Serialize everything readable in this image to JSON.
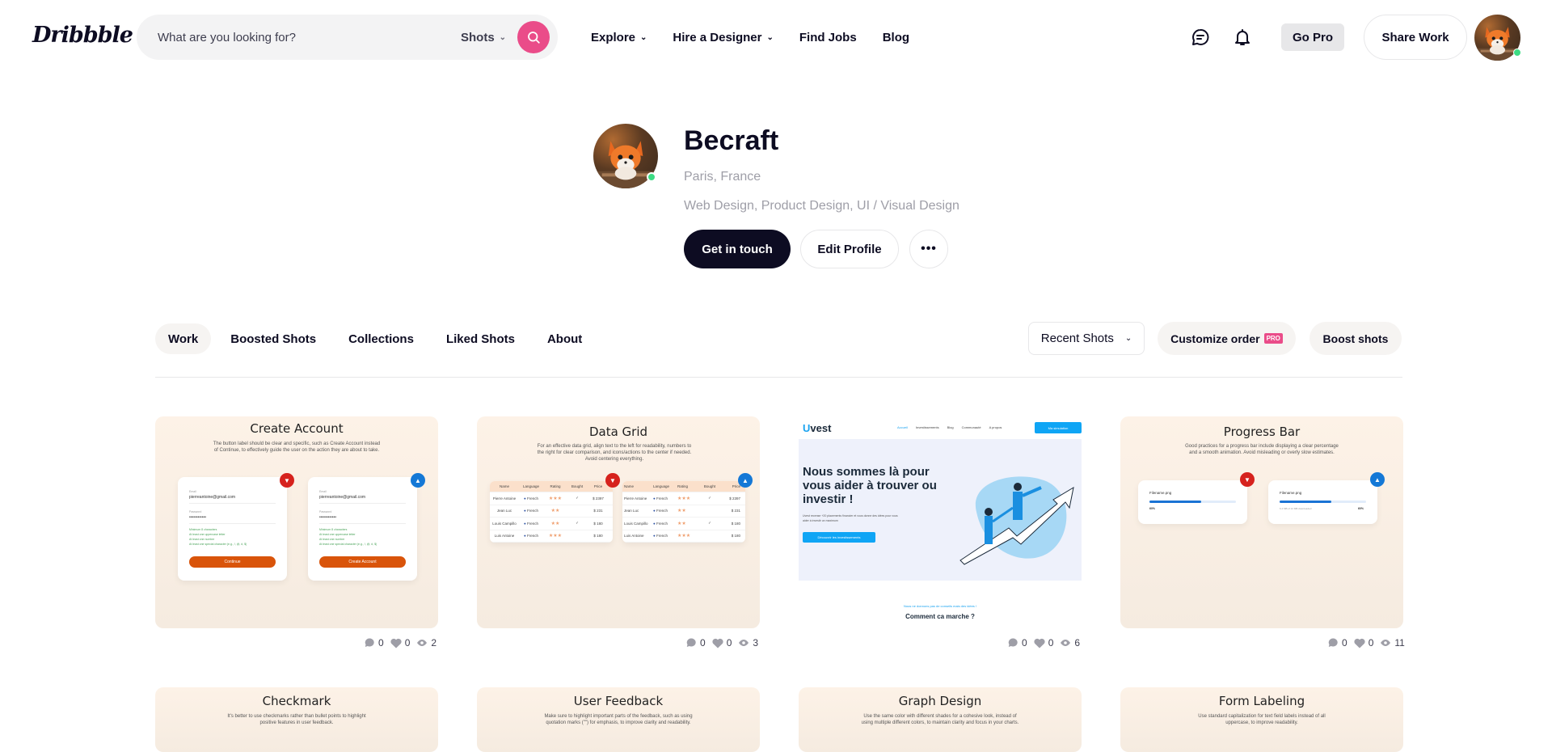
{
  "header": {
    "logo": "Dribbble",
    "search": {
      "placeholder": "What are you looking for?",
      "scope": "Shots"
    },
    "nav": [
      {
        "label": "Explore",
        "has_dropdown": true
      },
      {
        "label": "Hire a Designer",
        "has_dropdown": true
      },
      {
        "label": "Find Jobs",
        "has_dropdown": false
      },
      {
        "label": "Blog",
        "has_dropdown": false
      }
    ],
    "go_pro": "Go Pro",
    "share_work": "Share Work"
  },
  "profile": {
    "name": "Becraft",
    "location": "Paris, France",
    "skills": "Web Design, Product Design, UI / Visual Design",
    "get_in_touch": "Get in touch",
    "edit_profile": "Edit Profile",
    "more": "•••",
    "online": true
  },
  "tabs": [
    {
      "label": "Work",
      "active": true
    },
    {
      "label": "Boosted Shots",
      "active": false
    },
    {
      "label": "Collections",
      "active": false
    },
    {
      "label": "Liked Shots",
      "active": false
    },
    {
      "label": "About",
      "active": false
    }
  ],
  "controls": {
    "sort": "Recent Shots",
    "customize": "Customize order",
    "pro_badge": "PRO",
    "boost": "Boost shots"
  },
  "shots": [
    {
      "title": "Create Account",
      "description": "The button label should be clear and specific, such as Create Account instead of Continue, to effectively guide the user on the action they are about to take.",
      "email_label": "Email",
      "email": "pierreantoine@gmail.com",
      "password_label": "Password",
      "password": "••••••••••••",
      "rules": [
        "Minimum 8 characters",
        "At least one uppercase letter",
        "At least one number",
        "At least one special character (e.g., !, @, #, $)"
      ],
      "bad_button": "Continue",
      "good_button": "Create Account",
      "comments": "0",
      "likes": "0",
      "views": "2"
    },
    {
      "title": "Data Grid",
      "description": "For an effective data grid, align text to the left for readability, numbers to the right for clear comparison, and icons/actions to the center if needed. Avoid centering everything.",
      "columns": [
        "Name",
        "Language",
        "Rating",
        "Bought",
        "Price"
      ],
      "rows": [
        {
          "name": "Pierre Antoine",
          "language": "French",
          "rating": 3,
          "bought": true,
          "price": "$ 2397"
        },
        {
          "name": "Jean Luc",
          "language": "French",
          "rating": 2,
          "bought": false,
          "price": "$ 231"
        },
        {
          "name": "Louis Campillo",
          "language": "French",
          "rating": 2,
          "bought": true,
          "price": "$ 180"
        },
        {
          "name": "Luis Antoine",
          "language": "French",
          "rating": 3,
          "bought": false,
          "price": "$ 180"
        }
      ],
      "comments": "0",
      "likes": "0",
      "views": "3"
    },
    {
      "title": "Uvest",
      "brand_u": "U",
      "brand_rest": "vest",
      "nav": [
        "Accueil",
        "Investissements",
        "Blog",
        "Communauté",
        "A propos"
      ],
      "cta": "Ma simulation",
      "headline": "Nous sommes là pour vous aider à trouver ou investir !",
      "sub": "Uvest recense +20 placements financier et vous donne des idées pour vous aider à investir un maximum",
      "button": "Découvrir les investissements",
      "tagline": "Nous ne donnons pas de conseils mais des idées !",
      "section_title": "Comment ca marche ?",
      "comments": "0",
      "likes": "0",
      "views": "6"
    },
    {
      "title": "Progress Bar",
      "description": "Good practices for a progress bar include displaying a clear percentage and a smooth animation. Avoid misleading or overly slow estimates.",
      "filename": "Filename.png",
      "progress": 0.6,
      "percent_label": "60%",
      "size_label": "6.4 MB of 12 MB downloaded",
      "comments": "0",
      "likes": "0",
      "views": "11"
    }
  ],
  "shots_row2": [
    {
      "title": "Checkmark",
      "description": "It's better to use checkmarks rather than bullet points to highlight positive features in user feedback."
    },
    {
      "title": "User Feedback",
      "description": "Make sure to highlight important parts of the feedback, such as using quotation marks (\"\") for emphasis, to improve clarity and readability."
    },
    {
      "title": "Graph Design",
      "description": "Use the same color with different shades for a cohesive look, instead of using multiple different colors, to maintain clarity and focus in your charts."
    },
    {
      "title": "Form Labeling",
      "description": "Use standard capitalization for text field labels instead of all uppercase, to improve readability."
    }
  ],
  "colors": {
    "brand_pink": "#ea4c89",
    "dark": "#0d0c22",
    "online": "#3ddc84",
    "bad": "#d6221d",
    "good": "#1478d6"
  }
}
